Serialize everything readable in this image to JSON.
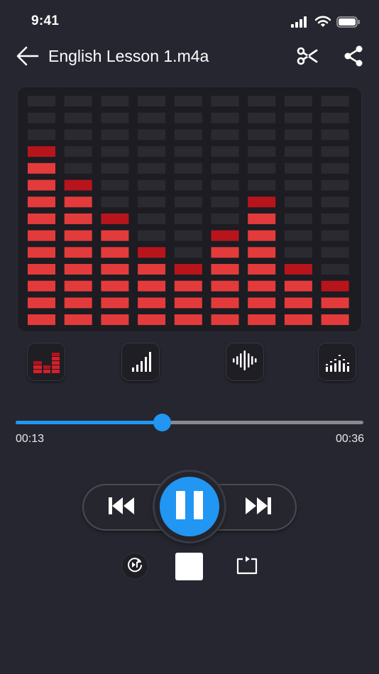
{
  "status_bar": {
    "time": "9:41"
  },
  "header": {
    "title": "English Lesson 1.m4a"
  },
  "equalizer": {
    "columns": 9,
    "segments": 14,
    "levels": [
      11,
      9,
      7,
      5,
      4,
      6,
      8,
      4,
      3
    ],
    "colors": {
      "lit": "#e33b3b",
      "lit_top": "#b8141c",
      "unlit": "#2a2a30",
      "panel": "#1c1c22"
    }
  },
  "modes": [
    {
      "name": "bars-mode",
      "icon": "equalizer-bars-icon",
      "active": true
    },
    {
      "name": "signal-mode",
      "icon": "signal-bars-icon",
      "active": false
    },
    {
      "name": "wave-mode",
      "icon": "waveform-icon",
      "active": false
    },
    {
      "name": "dots-mode",
      "icon": "dotted-bars-icon",
      "active": false
    }
  ],
  "player": {
    "current_time": "00:13",
    "total_time": "00:36",
    "progress": 0.42
  },
  "colors": {
    "accent": "#2196f3",
    "background": "#262630"
  }
}
